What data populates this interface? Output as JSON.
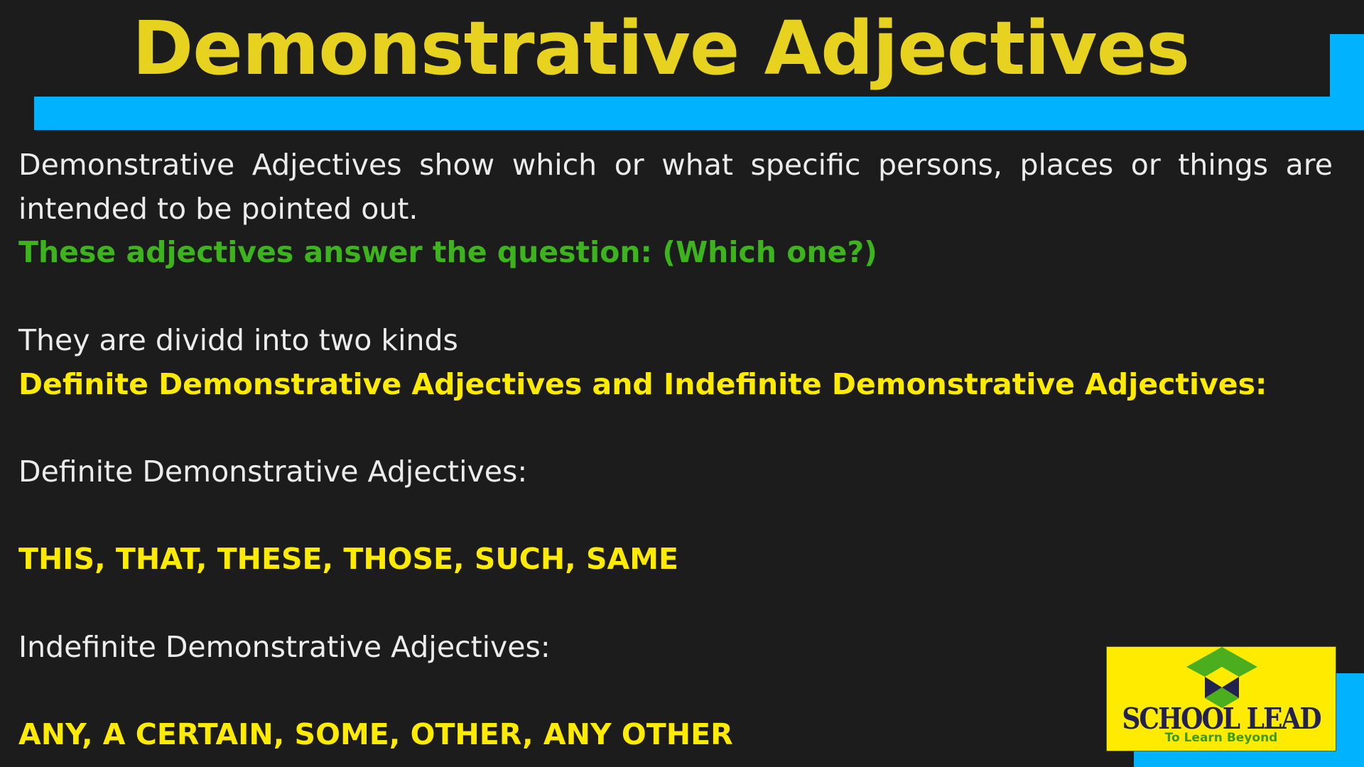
{
  "slide": {
    "title": "Demonstrative Adjectives",
    "colors": {
      "background": "#1c1c1c",
      "title": "#e6d21f",
      "accent_bar": "#00b2ff",
      "body_text": "#ececec",
      "highlight_green": "#3db41e",
      "highlight_yellow": "#ffeb00"
    },
    "body": {
      "intro": "Demonstrative Adjectives show which or what specific persons, places or things are intended to be pointed out.",
      "question_note": "These adjectives answer the question: (Which one?)",
      "kinds_intro": "They are dividd into two kinds",
      "kinds_heading": "Definite Demonstrative Adjectives and Indefinite Demonstrative Adjectives:",
      "definite_label": "Definite Demonstrative Adjectives:",
      "definite_list": "THIS, THAT, THESE, THOSE, SUCH, SAME",
      "indefinite_label": "Indefinite Demonstrative Adjectives:",
      "indefinite_list": "ANY, A CERTAIN, SOME, OTHER, ANY OTHER"
    },
    "logo": {
      "name": "SCHOOL LEAD",
      "tagline": "To Learn Beyond",
      "icon": "graduation-cap-icon"
    }
  }
}
